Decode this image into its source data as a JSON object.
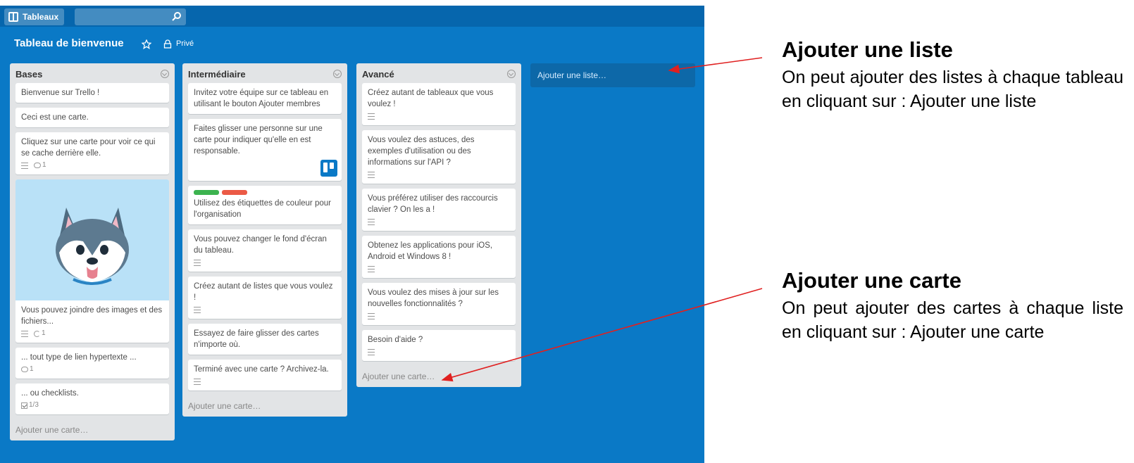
{
  "topbar": {
    "boards_label": "Tableaux",
    "search_placeholder": ""
  },
  "board": {
    "title": "Tableau de bienvenue",
    "privacy": "Privé"
  },
  "lists": [
    {
      "title": "Bases",
      "cards": [
        {
          "text": "Bienvenue sur Trello !"
        },
        {
          "text": "Ceci est une carte."
        },
        {
          "text": "Cliquez sur une carte pour voir ce qui se cache derrière elle.",
          "comments": "1"
        },
        {
          "text": "Vous pouvez joindre des images et des fichiers...",
          "attachments": "1"
        },
        {
          "text": "... tout type de lien hypertexte ...",
          "comments": "1"
        },
        {
          "text": "... ou checklists.",
          "checklist": "1/3"
        }
      ],
      "add_card": "Ajouter une carte…"
    },
    {
      "title": "Intermédiaire",
      "cards": [
        {
          "text": "Invitez votre équipe sur ce tableau en utilisant le bouton Ajouter membres"
        },
        {
          "text": "Faites glisser une personne sur une carte pour indiquer qu'elle en est responsable."
        },
        {
          "text": "Utilisez des étiquettes de couleur pour l'organisation"
        },
        {
          "text": "Vous pouvez changer le fond d'écran du tableau."
        },
        {
          "text": "Créez autant de listes que vous voulez !"
        },
        {
          "text": "Essayez de faire glisser des cartes n'importe où."
        },
        {
          "text": "Terminé avec une carte ? Archivez-la."
        }
      ],
      "add_card": "Ajouter une carte…"
    },
    {
      "title": "Avancé",
      "cards": [
        {
          "text": "Créez autant de tableaux que vous voulez !"
        },
        {
          "text": "Vous voulez des astuces, des exemples d'utilisation ou des informations sur l'API ?"
        },
        {
          "text": "Vous préférez utiliser des raccourcis clavier ? On les a !"
        },
        {
          "text": "Obtenez les applications pour iOS, Android et Windows 8 !"
        },
        {
          "text": "Vous voulez des mises à jour sur les nouvelles fonctionnalités ?"
        },
        {
          "text": "Besoin d'aide ?"
        }
      ],
      "add_card": "Ajouter une carte…"
    }
  ],
  "add_list": "Ajouter une liste…",
  "annotations": {
    "list": {
      "title": "Ajouter une liste",
      "text": "On peut ajouter des listes à chaque tableau en cliquant sur : Ajouter une liste"
    },
    "card": {
      "title": "Ajouter une carte",
      "text": "On peut ajouter des cartes à chaque liste en cliquant sur : Ajouter une carte"
    }
  },
  "colors": {
    "board_bg": "#0a79c6",
    "topbar_bg": "#0666ad",
    "label_green": "#3cb34f",
    "label_red": "#eb5a46",
    "arrow": "#e02020"
  }
}
